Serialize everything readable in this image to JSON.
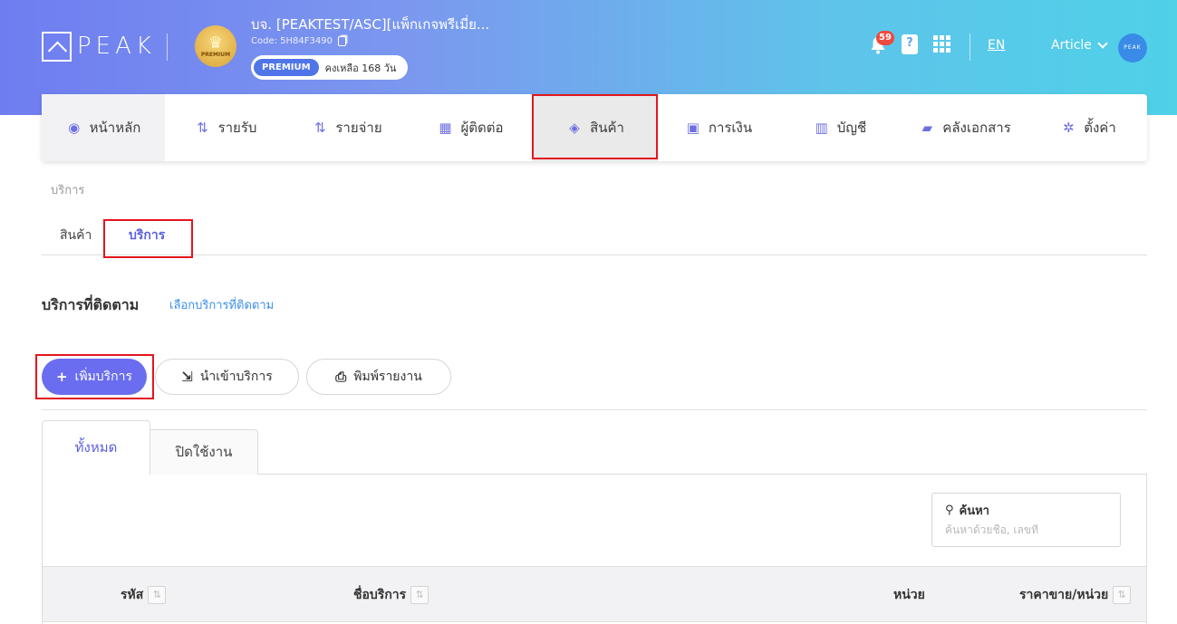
{
  "header": {
    "logo_text": "PEAK",
    "company_name": "บจ. [PEAKTEST/ASC][แพ็กเกจพรีเมี่ย...",
    "company_code": "Code: 5H84F3490",
    "avatar_text": "PREMIUM",
    "plan_tag": "PREMIUM",
    "plan_remaining": "คงเหลือ 168 วัน",
    "notification_count": "59",
    "help_glyph": "?",
    "language": "EN",
    "user_name": "Article",
    "user_avatar_text": "PEAK"
  },
  "nav": [
    {
      "label": "หน้าหลัก",
      "icon": "dashboard-icon",
      "glyph": "◉"
    },
    {
      "label": "รายรับ",
      "icon": "income-icon",
      "glyph": "⇅"
    },
    {
      "label": "รายจ่าย",
      "icon": "expense-icon",
      "glyph": "⇅"
    },
    {
      "label": "ผู้ติดต่อ",
      "icon": "contacts-icon",
      "glyph": "▦"
    },
    {
      "label": "สินค้า",
      "icon": "product-box-icon",
      "glyph": "◈"
    },
    {
      "label": "การเงิน",
      "icon": "money-icon",
      "glyph": "▣"
    },
    {
      "label": "บัญชี",
      "icon": "ledger-icon",
      "glyph": "▥"
    },
    {
      "label": "คลังเอกสาร",
      "icon": "folder-icon",
      "glyph": "▰"
    },
    {
      "label": "ตั้งค่า",
      "icon": "gear-icon",
      "glyph": "✲"
    }
  ],
  "breadcrumb": "บริการ",
  "sub_tabs": {
    "product": "สินค้า",
    "service": "บริการ"
  },
  "section": {
    "title": "บริการที่ติดตาม",
    "link": "เลือกบริการที่ติดตาม"
  },
  "buttons": {
    "add": "เพิ่มบริการ",
    "import": "นำเข้าบริการ",
    "print": "พิมพ์รายงาน",
    "add_glyph": "+",
    "import_glyph": "⇲",
    "print_glyph": "⎙"
  },
  "list_tabs": {
    "all": "ทั้งหมด",
    "disabled": "ปิดใช้งาน"
  },
  "search": {
    "label": "ค้นหา",
    "placeholder": "ค้นหาด้วยชื่อ, เลขที่",
    "glyph": "⚲"
  },
  "table": {
    "sort_glyph": "⇅",
    "columns": [
      "รหัส",
      "ชื่อบริการ",
      "หน่วย",
      "ราคาขาย/หน่วย"
    ]
  },
  "colors": {
    "accent": "#6a6df0",
    "highlight": "#e3161f",
    "link": "#3d8fe6"
  }
}
